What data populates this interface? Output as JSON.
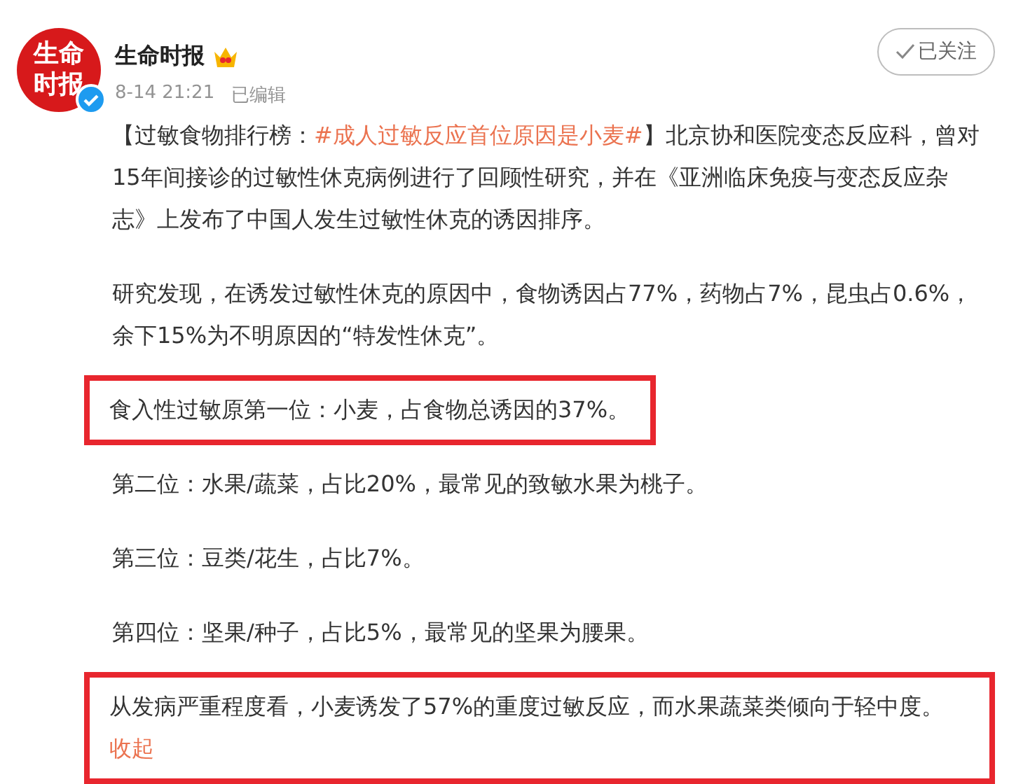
{
  "post": {
    "avatar_text": [
      "生命",
      "时报"
    ],
    "verified": true,
    "author": "生命时报",
    "member_badge": true,
    "time": "8-14 21:21",
    "edited": "已编辑",
    "follow": {
      "label": "已关注",
      "following": true
    },
    "paragraphs": [
      {
        "text": "【过敏食物排行榜：",
        "topic": "#成人过敏反应首位原因是小麦#",
        "rest": "】北京协和医院变态反应科，曾对15年间接诊的过敏性休克病例进行了回顾性研究，并在《亚洲临床免疫与变态反应杂志》上发布了中国人发生过敏性休克的诱因排序。",
        "highlighted": false
      },
      {
        "text": "研究发现，在诱发过敏性休克的原因中，食物诱因占77%，药物占7%，昆虫占0.6%，余下15%为不明原因的“特发性休克”。",
        "highlighted": false
      },
      {
        "text": "食入性过敏原第一位：小麦，占食物总诱因的37%。",
        "highlighted": true
      },
      {
        "text": "第二位：水果/蔬菜，占比20%，最常见的致敏水果为桃子。",
        "highlighted": false
      },
      {
        "text": "第三位：豆类/花生，占比7%。",
        "highlighted": false
      },
      {
        "text": "第四位：坚果/种子，占比5%，最常见的坚果为腰果。",
        "highlighted": false
      },
      {
        "text": "从发病严重程度看，小麦诱发了57%的重度过敏反应，而水果蔬菜类倾向于轻中度。",
        "highlighted": true
      }
    ],
    "collapse_link": "收起"
  }
}
